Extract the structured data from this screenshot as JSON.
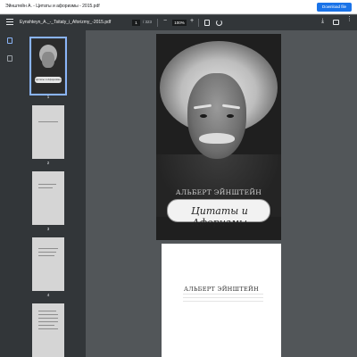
{
  "header": {
    "title": "Эйнштейн А. - Цитаты и афоризмы - 2015.pdf",
    "download_button": "Download file"
  },
  "toolbar": {
    "file_name": "Eynshteyn_A._-_Tsitaty_i_Aforizmy_-2015.pdf",
    "current_page": "1",
    "page_total": "/ 323",
    "zoom": "100%",
    "icons": [
      "menu-icon",
      "zoom-out-icon",
      "zoom-in-icon",
      "fit-page-icon",
      "rotate-icon",
      "download-icon",
      "print-icon",
      "more-icon"
    ]
  },
  "sidebar": {
    "icons": [
      "thumbnails-icon",
      "outline-icon"
    ],
    "pages": [
      "1",
      "2",
      "3",
      "4"
    ],
    "thumb1_banner": "Цитаты и Афоризмы"
  },
  "document": {
    "cover_author": "АЛЬБЕРТ ЭЙНШТЕЙН",
    "cover_title": "Цитаты и Афоризмы",
    "page2_author": "АЛЬБЕРТ ЭЙНШТЕЙН"
  }
}
